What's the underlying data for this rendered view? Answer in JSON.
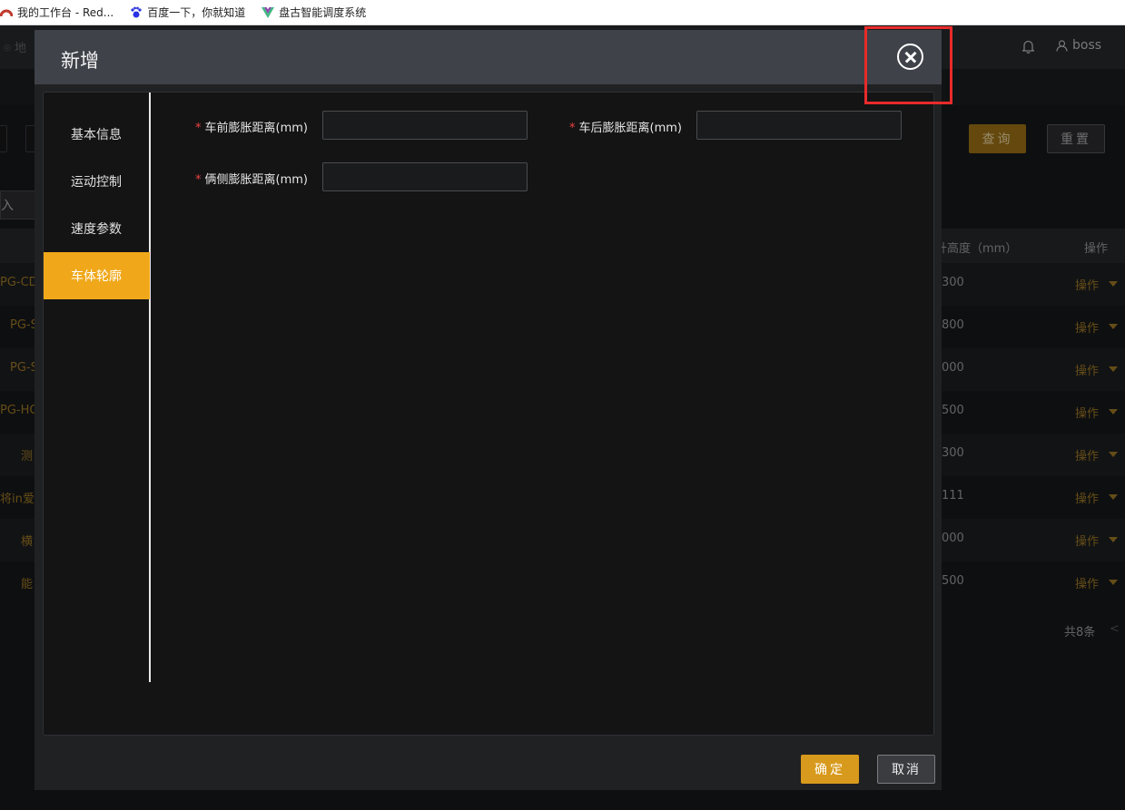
{
  "bookmarks": [
    {
      "label": "我的工作台 - Red...",
      "icon": "redmine-icon"
    },
    {
      "label": "百度一下，你就知道",
      "icon": "baidu-paw-icon"
    },
    {
      "label": "盘古智能调度系统",
      "icon": "vue-logo-icon"
    }
  ],
  "app": {
    "location_label": "地",
    "user_name": "boss",
    "query_label": "查询",
    "reset_label": "重置",
    "import_label": "导入",
    "columns": {
      "height": "升高度（mm）",
      "op": "操作"
    },
    "rows": [
      {
        "name": "PG-CD",
        "height": "300",
        "op": "操作"
      },
      {
        "name": "PG-S",
        "height": "800",
        "op": "操作"
      },
      {
        "name": "PG-S",
        "height": "000",
        "op": "操作"
      },
      {
        "name": "PG-HC",
        "height": "500",
        "op": "操作"
      },
      {
        "name": "测",
        "height": "300",
        "op": "操作"
      },
      {
        "name": "将in爱",
        "height": "111",
        "op": "操作"
      },
      {
        "name": "横",
        "height": "000",
        "op": "操作"
      },
      {
        "name": "能",
        "height": "500",
        "op": "操作"
      }
    ],
    "total": "共8条"
  },
  "modal": {
    "title": "新增",
    "tabs": [
      {
        "label": "基本信息",
        "active": false
      },
      {
        "label": "运动控制",
        "active": false
      },
      {
        "label": "速度参数",
        "active": false
      },
      {
        "label": "车体轮廓",
        "active": true
      }
    ],
    "fields": {
      "front": {
        "label": "车前膨胀距离(mm)",
        "value": ""
      },
      "rear": {
        "label": "车后膨胀距离(mm)",
        "value": ""
      },
      "side": {
        "label": "俩侧膨胀距离(mm)",
        "value": ""
      }
    },
    "required_mark": "*",
    "confirm_label": "确定",
    "cancel_label": "取消"
  },
  "colors": {
    "accent": "#f0a81a",
    "highlight_box": "#e82b2b",
    "required": "#f04040"
  }
}
